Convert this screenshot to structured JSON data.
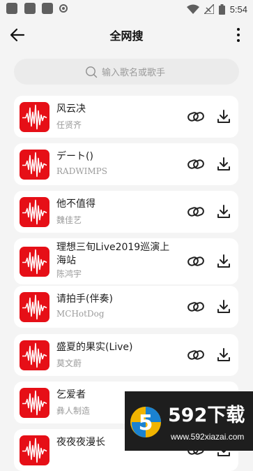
{
  "status_bar": {
    "time": "5:54"
  },
  "header": {
    "title": "全网搜"
  },
  "search": {
    "placeholder": "输入歌名或歌手"
  },
  "songs": [
    {
      "title": "风云决",
      "artist": "任贤齐"
    },
    {
      "title": "デート()",
      "artist": "RADWIMPS"
    },
    {
      "title": "他不值得",
      "artist": "魏佳艺"
    },
    {
      "title": "理想三旬Live2019巡演上海站",
      "artist": "陈鸿宇"
    },
    {
      "title": "请拍手(伴奏)",
      "artist": "MCHotDog"
    },
    {
      "title": "盛夏的果实(Live)",
      "artist": "莫文蔚"
    },
    {
      "title": "乞爱者",
      "artist": "彝人制造"
    },
    {
      "title": "夜夜夜漫长",
      "artist": ""
    }
  ],
  "watermark": {
    "brand": "592下载",
    "url": "www.592xiazai.com"
  },
  "colors": {
    "cover_red": "#e60f17",
    "background": "#f4f4f4",
    "card": "#ffffff"
  }
}
